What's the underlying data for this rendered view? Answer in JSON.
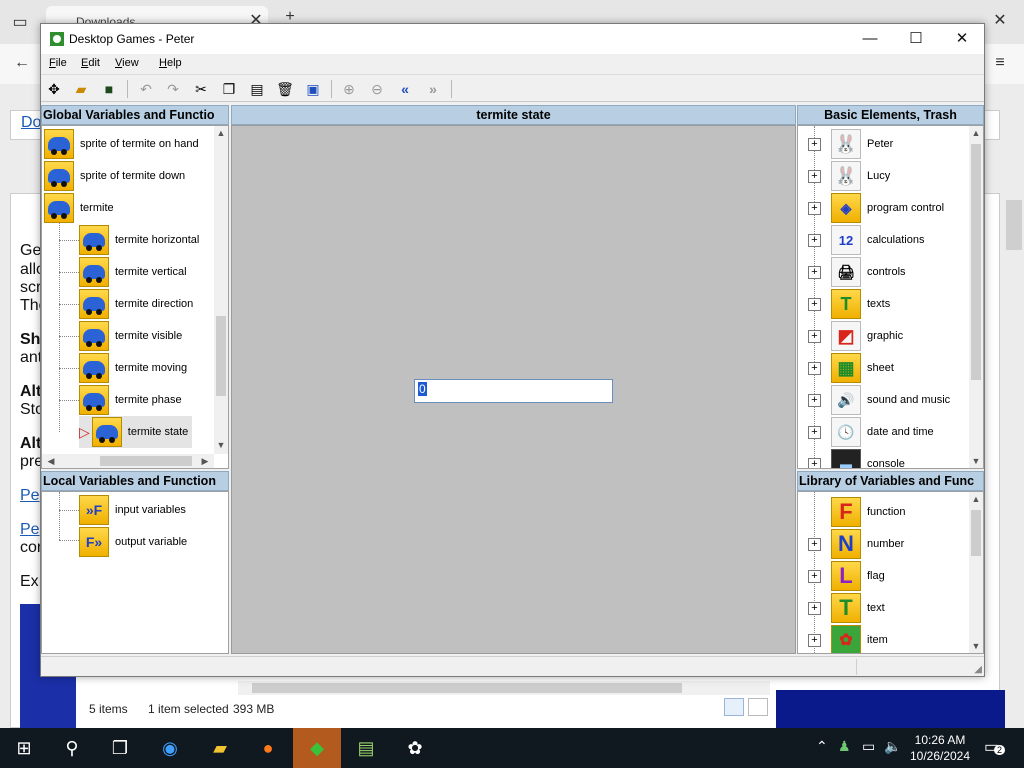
{
  "background": {
    "browser_tab_label": "Downloads",
    "left_link_text": "Do",
    "fragments": [
      "Ge",
      "allo",
      "scr",
      "The",
      "Sh",
      "ant",
      "Alt",
      "Sto",
      "Alt",
      "pre",
      "Pe",
      "Pe",
      "cor",
      "Ex"
    ],
    "explorer_status": {
      "items": "5 items",
      "selected": "1 item selected",
      "size": "393 MB"
    }
  },
  "window": {
    "title": "Desktop Games - Peter",
    "controls": {
      "minimize": "—",
      "maximize": "☐",
      "close": "✕"
    }
  },
  "menu": {
    "file": "File",
    "edit": "Edit",
    "view": "View",
    "help": "Help"
  },
  "toolbar": {
    "icons": [
      "network-icon",
      "open-folder-icon",
      "save-icon",
      "undo-icon",
      "redo-icon",
      "cut-icon",
      "copy-icon",
      "paste-icon",
      "delete-icon",
      "select-all-icon",
      "zoom-in-icon",
      "zoom-out-icon",
      "back-icon",
      "forward-icon"
    ]
  },
  "global_panel": {
    "title": "Global Variables and Functio",
    "items": [
      {
        "label": "sprite of termite on hand",
        "level": 0
      },
      {
        "label": "sprite of termite down",
        "level": 0
      },
      {
        "label": "termite",
        "level": 0
      },
      {
        "label": "termite horizontal",
        "level": 1
      },
      {
        "label": "termite vertical",
        "level": 1
      },
      {
        "label": "termite direction",
        "level": 1
      },
      {
        "label": "termite visible",
        "level": 1
      },
      {
        "label": "termite moving",
        "level": 1
      },
      {
        "label": "termite phase",
        "level": 1
      },
      {
        "label": "termite state",
        "level": 1,
        "selected": true
      }
    ]
  },
  "local_panel": {
    "title": "Local Variables and Function",
    "items": [
      {
        "label": "input variables",
        "glyph": "»F"
      },
      {
        "label": "output variable",
        "glyph": "F»"
      }
    ]
  },
  "center_panel": {
    "title": "termite state",
    "edit_value": "0"
  },
  "basic_panel": {
    "title": "Basic Elements, Trash",
    "items": [
      {
        "label": "Peter",
        "glyph": "🐰"
      },
      {
        "label": "Lucy",
        "glyph": "🐰"
      },
      {
        "label": "program control",
        "glyph": "◈"
      },
      {
        "label": "calculations",
        "glyph": "12"
      },
      {
        "label": "controls",
        "glyph": "🖨"
      },
      {
        "label": "texts",
        "glyph": "T"
      },
      {
        "label": "graphic",
        "glyph": "◩"
      },
      {
        "label": "sheet",
        "glyph": "▦"
      },
      {
        "label": "sound and music",
        "glyph": "🔊"
      },
      {
        "label": "date and time",
        "glyph": "🕓"
      },
      {
        "label": "console",
        "glyph": "▬"
      }
    ]
  },
  "library_panel": {
    "title": "Library of Variables and Func",
    "items": [
      {
        "label": "function",
        "glyph": "F",
        "color": "#d9261c",
        "expander": false
      },
      {
        "label": "number",
        "glyph": "N",
        "color": "#1f3fc8",
        "expander": true
      },
      {
        "label": "flag",
        "glyph": "L",
        "color": "#8c1fc8",
        "expander": true
      },
      {
        "label": "text",
        "glyph": "T",
        "color": "#1f8c2a",
        "expander": true
      },
      {
        "label": "item",
        "glyph": "✿",
        "color": "#d9261c",
        "expander": true
      }
    ]
  },
  "taskbar": {
    "time": "10:26 AM",
    "date": "10/26/2024",
    "notifications": "2"
  }
}
